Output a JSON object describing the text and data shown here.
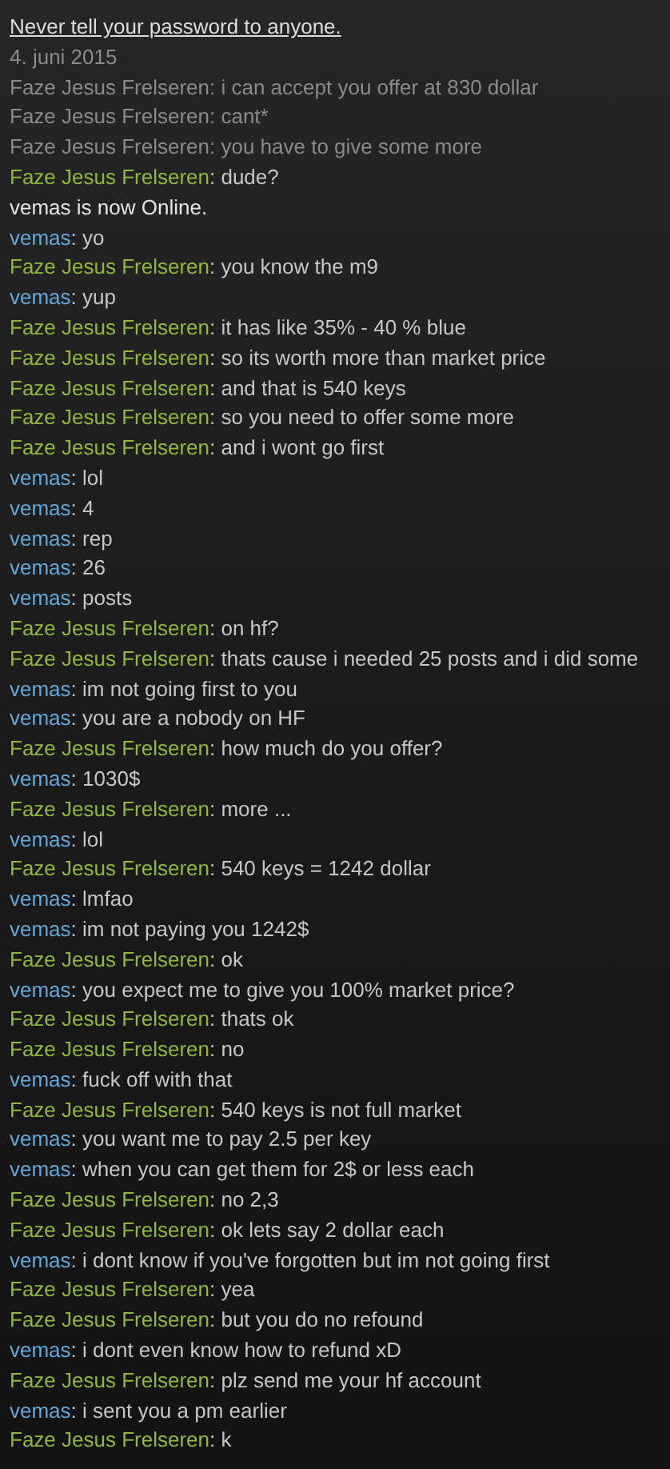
{
  "notice": "Never tell your password to anyone.",
  "date": "4. juni 2015",
  "lines": [
    {
      "kind": "history",
      "sender": "Faze Jesus Frelseren",
      "text": ": i can accept you offer at 830 dollar"
    },
    {
      "kind": "history",
      "sender": "Faze Jesus Frelseren",
      "text": ": cant*"
    },
    {
      "kind": "history",
      "sender": "Faze Jesus Frelseren",
      "text": ": you have to give some more"
    },
    {
      "kind": "friend",
      "sender": "Faze Jesus Frelseren",
      "text": ": dude?"
    },
    {
      "kind": "status",
      "text": "vemas is now Online."
    },
    {
      "kind": "self",
      "sender": "vemas",
      "text": ": yo"
    },
    {
      "kind": "friend",
      "sender": "Faze Jesus Frelseren",
      "text": ": you know the m9"
    },
    {
      "kind": "self",
      "sender": "vemas",
      "text": ": yup"
    },
    {
      "kind": "friend",
      "sender": "Faze Jesus Frelseren",
      "text": ": it has like 35% - 40 % blue"
    },
    {
      "kind": "friend",
      "sender": "Faze Jesus Frelseren",
      "text": ": so its worth more than market price"
    },
    {
      "kind": "friend",
      "sender": "Faze Jesus Frelseren",
      "text": ": and that is 540 keys"
    },
    {
      "kind": "friend",
      "sender": "Faze Jesus Frelseren",
      "text": ": so you need to offer some more"
    },
    {
      "kind": "friend",
      "sender": "Faze Jesus Frelseren",
      "text": ": and i wont go first"
    },
    {
      "kind": "self",
      "sender": "vemas",
      "text": ": lol"
    },
    {
      "kind": "self",
      "sender": "vemas",
      "text": ": 4"
    },
    {
      "kind": "self",
      "sender": "vemas",
      "text": ": rep"
    },
    {
      "kind": "self",
      "sender": "vemas",
      "text": ": 26"
    },
    {
      "kind": "self",
      "sender": "vemas",
      "text": ": posts"
    },
    {
      "kind": "friend",
      "sender": "Faze Jesus Frelseren",
      "text": ": on hf?"
    },
    {
      "kind": "friend",
      "sender": "Faze Jesus Frelseren",
      "text": ": thats cause i needed 25 posts and i did some"
    },
    {
      "kind": "self",
      "sender": "vemas",
      "text": ": im not going first to you"
    },
    {
      "kind": "self",
      "sender": "vemas",
      "text": ": you are a nobody on HF"
    },
    {
      "kind": "friend",
      "sender": "Faze Jesus Frelseren",
      "text": ": how much do you offer?"
    },
    {
      "kind": "self",
      "sender": "vemas",
      "text": ": 1030$"
    },
    {
      "kind": "friend",
      "sender": "Faze Jesus Frelseren",
      "text": ": more ..."
    },
    {
      "kind": "self",
      "sender": "vemas",
      "text": ": lol"
    },
    {
      "kind": "friend",
      "sender": "Faze Jesus Frelseren",
      "text": ": 540 keys = 1242 dollar"
    },
    {
      "kind": "self",
      "sender": "vemas",
      "text": ": lmfao"
    },
    {
      "kind": "self",
      "sender": "vemas",
      "text": ": im not paying you 1242$"
    },
    {
      "kind": "friend",
      "sender": "Faze Jesus Frelseren",
      "text": ": ok"
    },
    {
      "kind": "self",
      "sender": "vemas",
      "text": ": you expect me to give you 100% market price?"
    },
    {
      "kind": "friend",
      "sender": "Faze Jesus Frelseren",
      "text": ": thats ok"
    },
    {
      "kind": "friend",
      "sender": "Faze Jesus Frelseren",
      "text": ": no"
    },
    {
      "kind": "self",
      "sender": "vemas",
      "text": ": fuck off with that"
    },
    {
      "kind": "friend",
      "sender": "Faze Jesus Frelseren",
      "text": ": 540 keys is not full market"
    },
    {
      "kind": "self",
      "sender": "vemas",
      "text": ": you want me to pay 2.5 per key"
    },
    {
      "kind": "self",
      "sender": "vemas",
      "text": ": when you can get them for 2$ or less each"
    },
    {
      "kind": "friend",
      "sender": "Faze Jesus Frelseren",
      "text": ": no 2,3"
    },
    {
      "kind": "friend",
      "sender": "Faze Jesus Frelseren",
      "text": ": ok lets say 2 dollar each"
    },
    {
      "kind": "self",
      "sender": "vemas",
      "text": ": i dont know if you've forgotten but im not going first"
    },
    {
      "kind": "friend",
      "sender": "Faze Jesus Frelseren",
      "text": ": yea"
    },
    {
      "kind": "friend",
      "sender": "Faze Jesus Frelseren",
      "text": ": but you do no refound"
    },
    {
      "kind": "self",
      "sender": "vemas",
      "text": ": i dont even know how to refund xD"
    },
    {
      "kind": "friend",
      "sender": "Faze Jesus Frelseren",
      "text": ": plz send me your hf account"
    },
    {
      "kind": "self",
      "sender": "vemas",
      "text": ": i sent you a pm earlier"
    },
    {
      "kind": "friend",
      "sender": "Faze Jesus Frelseren",
      "text": ": k"
    }
  ]
}
